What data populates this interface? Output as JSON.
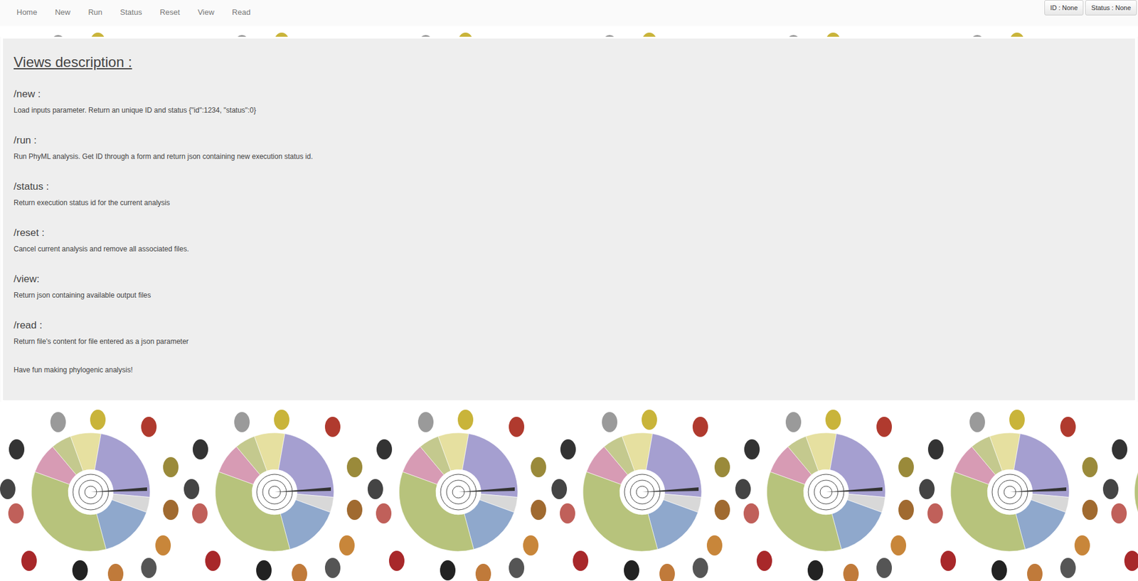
{
  "nav": {
    "items": [
      "Home",
      "New",
      "Run",
      "Status",
      "Reset",
      "View",
      "Read"
    ]
  },
  "indicators": [
    "ID : None",
    "Status : None"
  ],
  "panel": {
    "title": "Views description :",
    "views": [
      {
        "route": "/new :",
        "description": "Load inputs parameter. Return an unique ID and status {\"id\":1234, \"status\":0}"
      },
      {
        "route": "/run :",
        "description": "Run PhyML analysis. Get ID through a form and return json containing new execution status id."
      },
      {
        "route": "/status :",
        "description": "Return execution status id for the current analysis"
      },
      {
        "route": "/reset :",
        "description": "Cancel current analysis and remove all associated files."
      },
      {
        "route": "/view:",
        "description": "Return json containing available output files"
      },
      {
        "route": "/read :",
        "description": "Return file's content for file entered as a json parameter"
      }
    ],
    "footer": "Have fun making phylogenic analysis!"
  }
}
